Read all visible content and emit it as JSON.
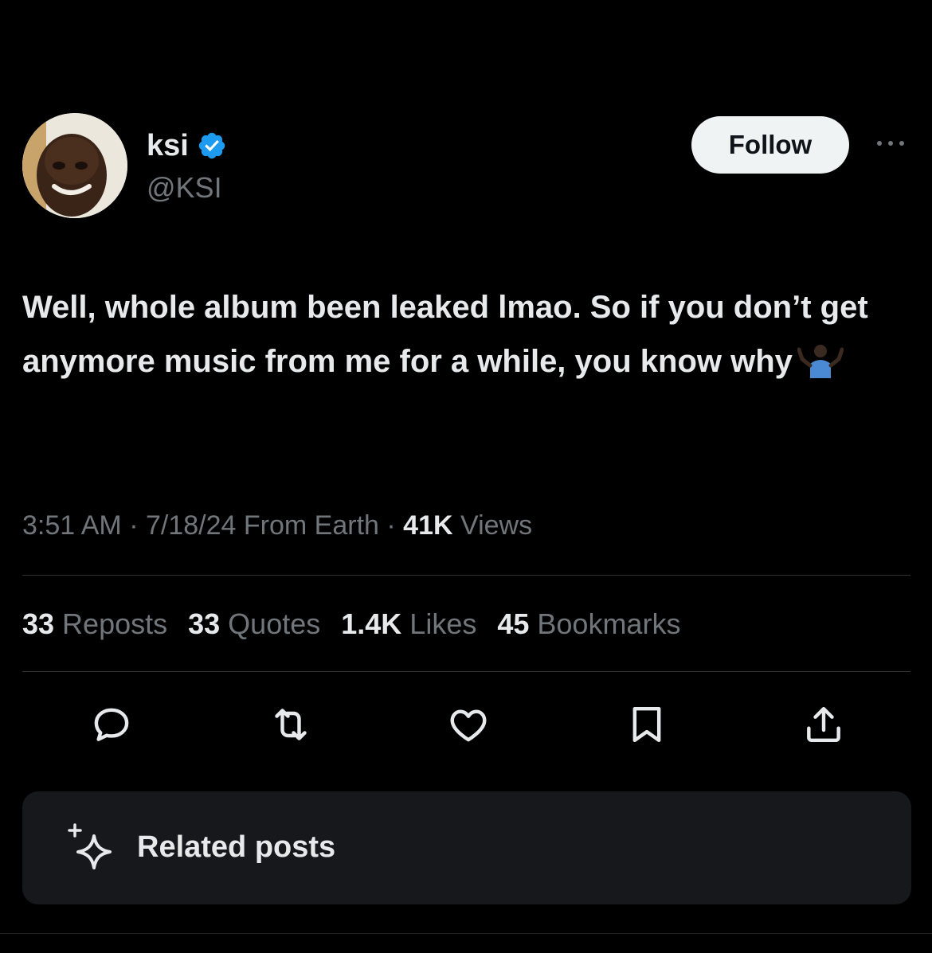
{
  "author": {
    "display_name": "ksi",
    "handle": "@KSI",
    "verified": true
  },
  "follow_label": "Follow",
  "tweet": {
    "text": "Well, whole album been leaked lmao. So if you don’t get anymore music from me for a while, you know why",
    "emoji": "shrugging-man-emoji"
  },
  "meta": {
    "time": "3:51 AM",
    "separator": "·",
    "date": "7/18/24",
    "location": "From Earth",
    "views_count": "41K",
    "views_label": "Views"
  },
  "stats": {
    "reposts": {
      "count": "33",
      "label": "Reposts"
    },
    "quotes": {
      "count": "33",
      "label": "Quotes"
    },
    "likes": {
      "count": "1.4K",
      "label": "Likes"
    },
    "bookmarks": {
      "count": "45",
      "label": "Bookmarks"
    }
  },
  "actions": [
    "reply-icon",
    "repost-icon",
    "like-icon",
    "bookmark-icon",
    "share-icon"
  ],
  "related": {
    "label": "Related posts"
  },
  "colors": {
    "background": "#000000",
    "text_primary": "#e7e9ea",
    "text_secondary": "#71767b",
    "verified": "#1d9bf0",
    "divider": "#2f3336",
    "card": "#16181c"
  }
}
